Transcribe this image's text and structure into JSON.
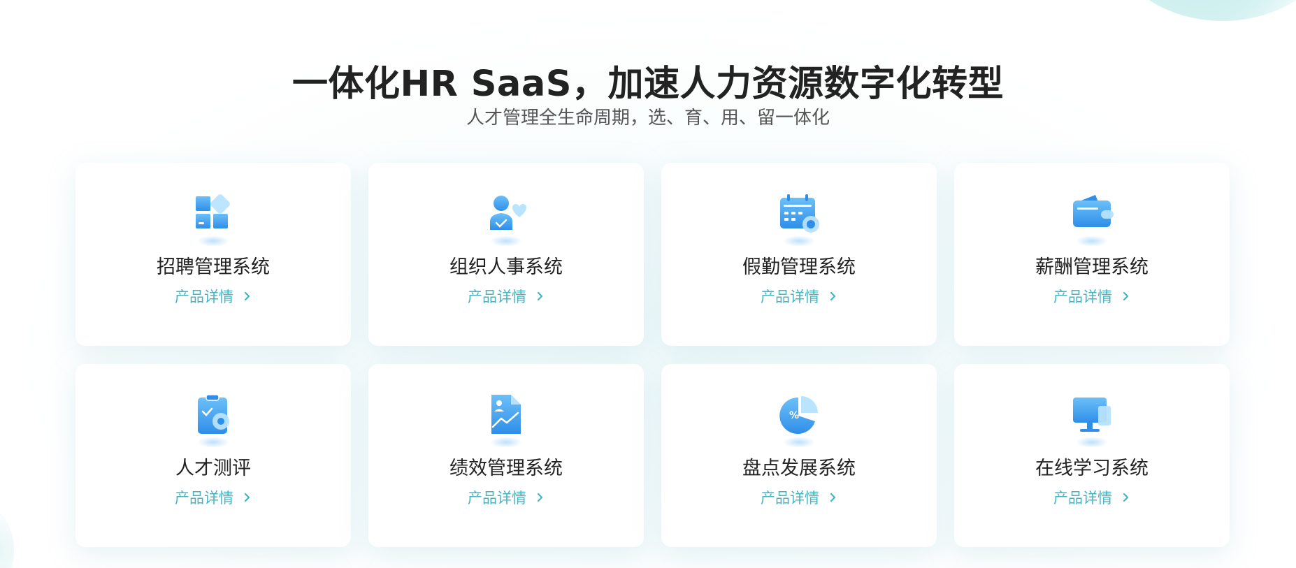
{
  "header": {
    "title": "一体化HR SaaS，加速人力资源数字化转型",
    "subtitle": "人才管理全生命周期，选、育、用、留一体化"
  },
  "colors": {
    "accent": "#42b6c3",
    "icon_blue": "#3d9bf0",
    "icon_light": "#9fd7fb",
    "text_dark": "#222222",
    "text_sub": "#555555"
  },
  "products": [
    {
      "name": "招聘管理系统",
      "link": "产品详情",
      "icon": "recruit-icon"
    },
    {
      "name": "组织人事系统",
      "link": "产品详情",
      "icon": "org-person-icon"
    },
    {
      "name": "假勤管理系统",
      "link": "产品详情",
      "icon": "calendar-icon"
    },
    {
      "name": "薪酬管理系统",
      "link": "产品详情",
      "icon": "wallet-icon"
    },
    {
      "name": "人才测评",
      "link": "产品详情",
      "icon": "clipboard-icon"
    },
    {
      "name": "绩效管理系统",
      "link": "产品详情",
      "icon": "performance-chart-icon"
    },
    {
      "name": "盘点发展系统",
      "link": "产品详情",
      "icon": "pie-chart-icon"
    },
    {
      "name": "在线学习系统",
      "link": "产品详情",
      "icon": "monitor-icon"
    }
  ]
}
